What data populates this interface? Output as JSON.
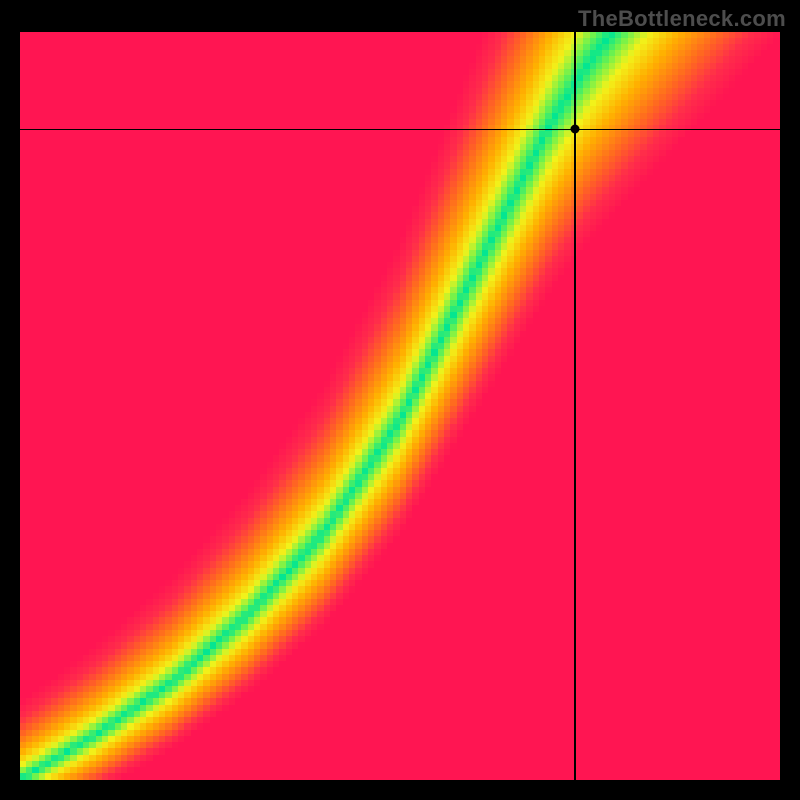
{
  "watermark": "TheBottleneck.com",
  "chart_data": {
    "type": "heatmap",
    "title": "",
    "xlabel": "",
    "ylabel": "",
    "xlim": [
      0,
      100
    ],
    "ylim": [
      0,
      100
    ],
    "crosshair": {
      "x": 73,
      "y": 87
    },
    "marker": {
      "x": 73,
      "y": 87
    },
    "ridge": {
      "description": "Curve of minimal bottleneck (green band center), y as function of x",
      "points": [
        {
          "x": 0,
          "y": 0
        },
        {
          "x": 10,
          "y": 6
        },
        {
          "x": 20,
          "y": 13
        },
        {
          "x": 30,
          "y": 22
        },
        {
          "x": 40,
          "y": 33
        },
        {
          "x": 50,
          "y": 48
        },
        {
          "x": 55,
          "y": 58
        },
        {
          "x": 60,
          "y": 68
        },
        {
          "x": 65,
          "y": 78
        },
        {
          "x": 70,
          "y": 88
        },
        {
          "x": 75,
          "y": 96
        },
        {
          "x": 78,
          "y": 100
        }
      ]
    },
    "colorscale": {
      "description": "distance from ridge maps to color",
      "stops": [
        {
          "t": 0.0,
          "color": "#00e693"
        },
        {
          "t": 0.1,
          "color": "#6ef24d"
        },
        {
          "t": 0.22,
          "color": "#f2f21a"
        },
        {
          "t": 0.4,
          "color": "#ffb000"
        },
        {
          "t": 0.62,
          "color": "#ff6a1f"
        },
        {
          "t": 0.82,
          "color": "#ff2d4a"
        },
        {
          "t": 1.0,
          "color": "#ff1552"
        }
      ]
    },
    "grid_resolution": 120,
    "pixelated": true
  }
}
